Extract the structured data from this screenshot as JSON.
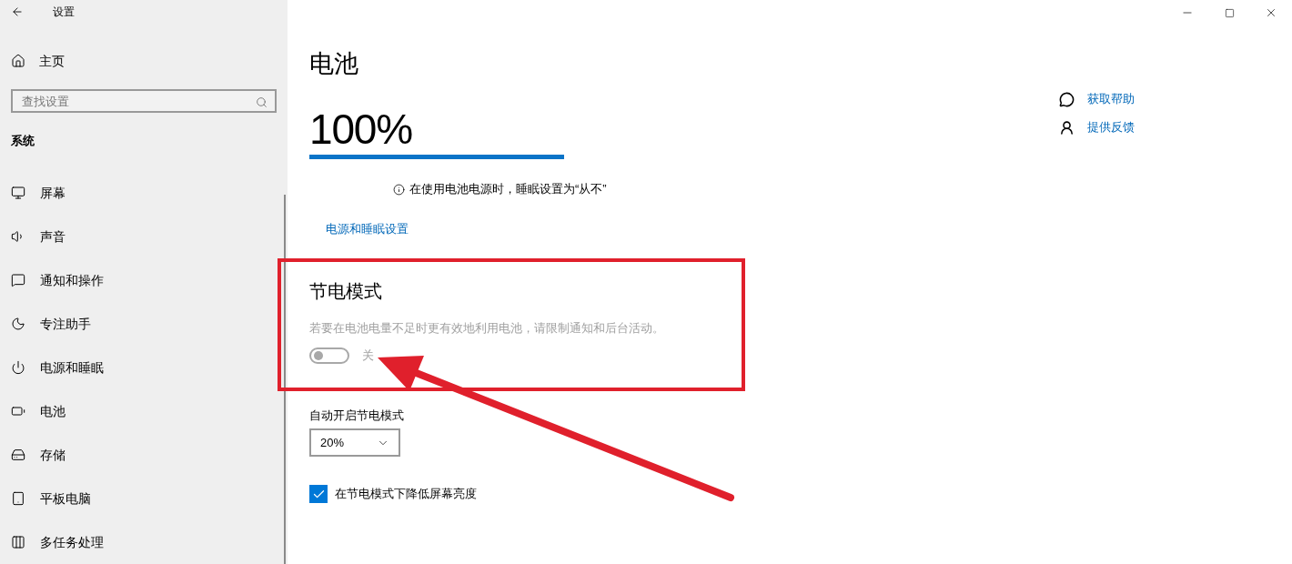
{
  "window": {
    "title": "设置"
  },
  "sidebar": {
    "home": "主页",
    "search": {
      "placeholder": "查找设置"
    },
    "section": "系统",
    "items": [
      {
        "label": "屏幕",
        "kind": "display"
      },
      {
        "label": "声音",
        "kind": "sound"
      },
      {
        "label": "通知和操作",
        "kind": "notifications"
      },
      {
        "label": "专注助手",
        "kind": "focus"
      },
      {
        "label": "电源和睡眠",
        "kind": "power"
      },
      {
        "label": "电池",
        "kind": "battery"
      },
      {
        "label": "存储",
        "kind": "storage"
      },
      {
        "label": "平板电脑",
        "kind": "tablet"
      },
      {
        "label": "多任务处理",
        "kind": "multitasking"
      }
    ]
  },
  "page": {
    "title": "电池",
    "percent": "100%",
    "level": 1,
    "note": "在使用电池电源时，睡眠设置为“从不”",
    "link": "电源和睡眠设置",
    "saver": {
      "title": "节电模式",
      "description": "若要在电池电量不足时更有效地利用电池，请限制通知和后台活动。",
      "toggle": {
        "on": false,
        "label": "关"
      }
    },
    "auto": {
      "label": "自动开启节电模式",
      "value": "20%"
    },
    "dim": {
      "checked": true,
      "label": "在节电模式下降低屏幕亮度"
    }
  },
  "help_links": [
    {
      "label": "获取帮助",
      "kind": "help"
    },
    {
      "label": "提供反馈",
      "kind": "feedback"
    }
  ]
}
